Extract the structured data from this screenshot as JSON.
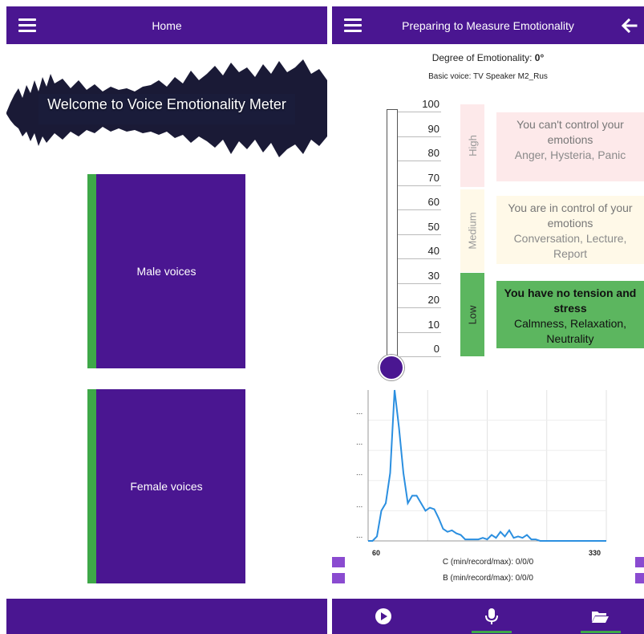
{
  "left_screen": {
    "appbar": {
      "title": "Home"
    },
    "banner": {
      "text": "Welcome to Voice Emotionality Meter"
    },
    "cards": [
      {
        "label": "Male voices"
      },
      {
        "label": "Female voices"
      }
    ]
  },
  "right_screen": {
    "appbar": {
      "title": "Preparing to Measure Emotionality"
    },
    "degree": {
      "label": "Degree of Emotionality:",
      "value": "0°"
    },
    "basic_voice": "Basic voice: TV Speaker M2_Rus",
    "scale_ticks": [
      "100",
      "90",
      "80",
      "70",
      "60",
      "50",
      "40",
      "30",
      "20",
      "10",
      "0"
    ],
    "thermometer_level": 0,
    "levels": [
      {
        "label": "High",
        "heading": "You can't control your emotions",
        "examples": "Anger, Hysteria, Panic"
      },
      {
        "label": "Medium",
        "heading": "You are in control of your emotions",
        "examples": "Conversation, Lecture, Report"
      },
      {
        "label": "Low",
        "heading": "You have no tension and stress",
        "examples": "Calmness, Relaxation, Neutrality"
      }
    ],
    "chart": {
      "y_labels": [
        "...",
        "...",
        "...",
        "...",
        "..."
      ],
      "x_min_label": "60",
      "x_max_label": "330"
    },
    "stats": {
      "c": "C (min/record/max): 0/0/0",
      "b": "B (min/record/max): 0/0/0"
    },
    "bottom_icons": [
      "play-icon",
      "microphone-icon",
      "folder-icon"
    ]
  },
  "colors": {
    "primary": "#4a1691",
    "accent_green": "#3ea848",
    "low_green": "#5cb65f",
    "high_pink": "#fde9ea",
    "medium_cream": "#fff9e8",
    "chart_line": "#2b8fe0"
  },
  "chart_data": {
    "type": "line",
    "x": [
      60,
      65,
      70,
      75,
      80,
      85,
      90,
      95,
      100,
      105,
      110,
      115,
      120,
      125,
      130,
      135,
      140,
      145,
      150,
      155,
      160,
      165,
      170,
      175,
      180,
      185,
      190,
      195,
      200,
      205,
      210,
      215,
      220,
      225,
      230,
      235,
      240,
      245,
      250,
      255,
      260,
      265,
      270,
      280,
      290,
      300,
      310,
      320,
      330
    ],
    "values": [
      0,
      0,
      3,
      20,
      25,
      45,
      100,
      75,
      45,
      25,
      30,
      30,
      25,
      20,
      22,
      21,
      15,
      8,
      6,
      7,
      5,
      4,
      1,
      1,
      1,
      1,
      2,
      1,
      4,
      2,
      6,
      3,
      7,
      2,
      3,
      2,
      4,
      1,
      1,
      0,
      0,
      0,
      0,
      0,
      0,
      0,
      0,
      0,
      0
    ],
    "xlim": [
      60,
      330
    ],
    "ylim": [
      0,
      100
    ],
    "xlabel": "",
    "ylabel": "",
    "grid": true
  }
}
